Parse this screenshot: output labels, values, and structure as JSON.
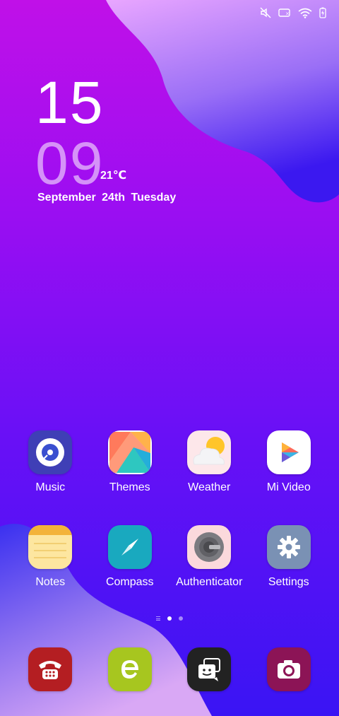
{
  "status_bar": {
    "icons": [
      "mute-icon",
      "battery-saver-icon",
      "wifi-icon",
      "battery-charging-icon"
    ]
  },
  "clock": {
    "hour": "15",
    "minute": "09",
    "temperature": "21℃",
    "date": "September 24th Tuesday"
  },
  "apps_row1": [
    {
      "label": "Music",
      "icon": "music-disc-icon"
    },
    {
      "label": "Themes",
      "icon": "themes-icon"
    },
    {
      "label": "Weather",
      "icon": "weather-icon"
    },
    {
      "label": "Mi Video",
      "icon": "play-icon"
    }
  ],
  "apps_row2": [
    {
      "label": "Notes",
      "icon": "notepad-icon"
    },
    {
      "label": "Compass",
      "icon": "compass-icon"
    },
    {
      "label": "Authenticator",
      "icon": "authenticator-lock-icon"
    },
    {
      "label": "Settings",
      "icon": "gear-icon"
    }
  ],
  "page_indicator": {
    "pages": 2,
    "active": 1
  },
  "dock": [
    {
      "icon": "phone-icon",
      "color": "#b41e22"
    },
    {
      "icon": "browser-icon",
      "color": "#a7c61f"
    },
    {
      "icon": "messaging-icon",
      "color": "#222222"
    },
    {
      "icon": "camera-icon",
      "color": "#8c1456"
    }
  ]
}
